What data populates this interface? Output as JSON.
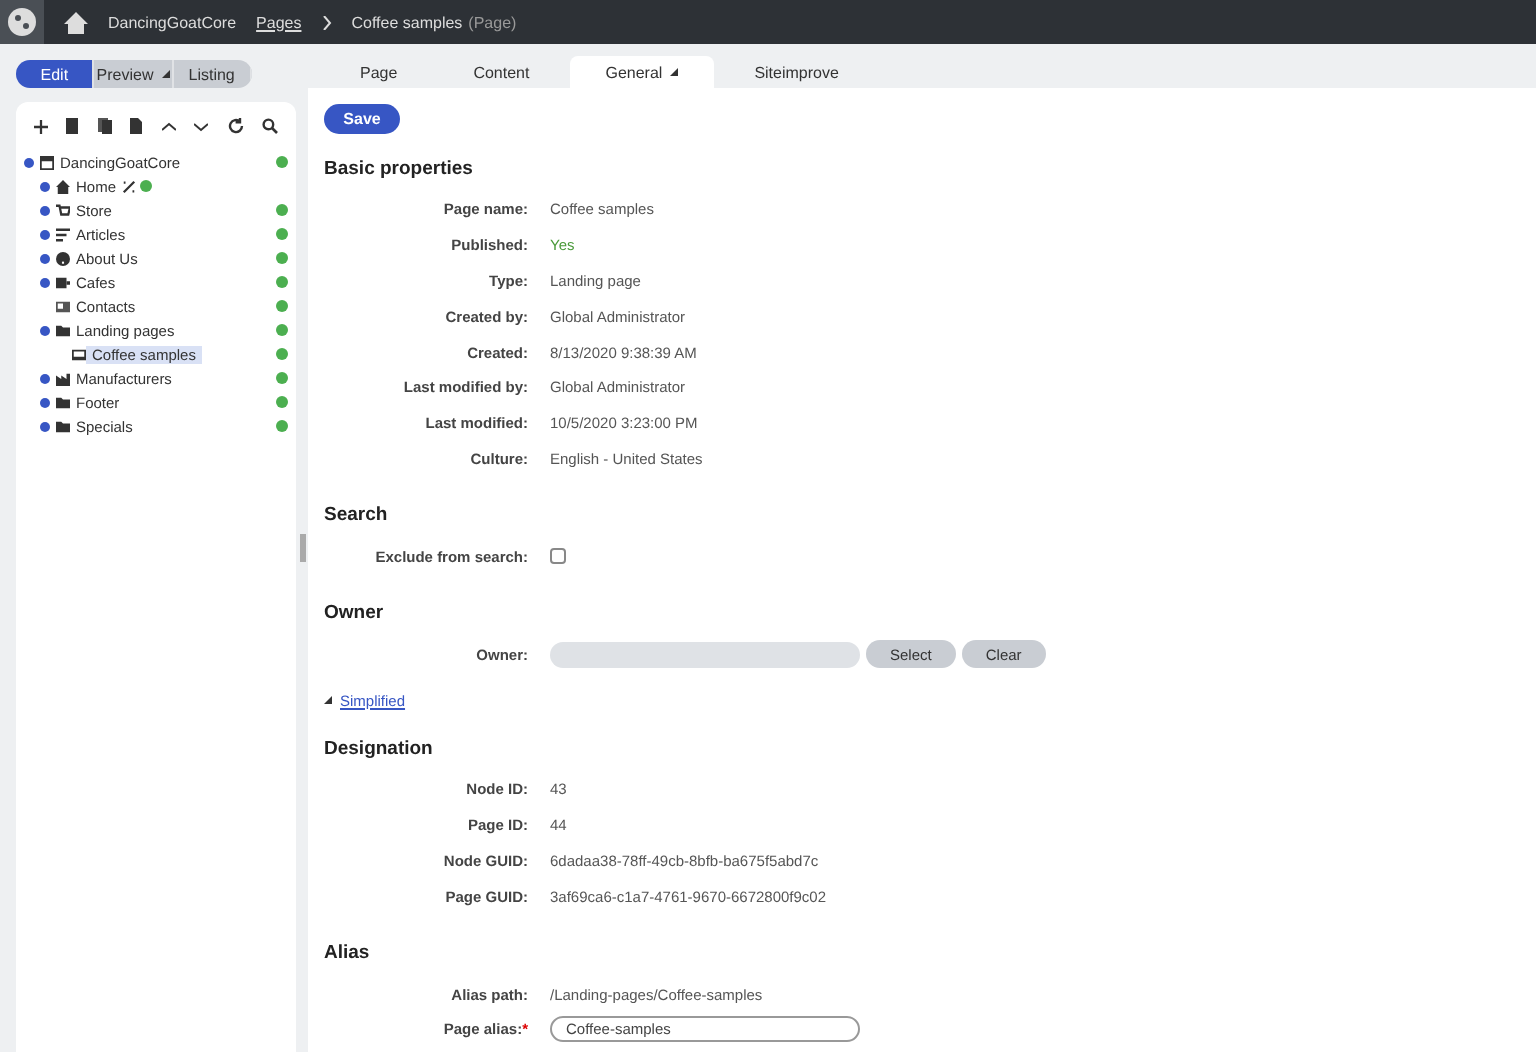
{
  "top_bar": {
    "site": "DancingGoatCore",
    "breadcrumb": [
      {
        "label": "Pages",
        "link": true
      },
      {
        "label": "Coffee samples",
        "link": false
      }
    ],
    "breadcrumb_type": "(Page)"
  },
  "modes": [
    {
      "label": "Edit",
      "selected": true
    },
    {
      "label": "Preview",
      "selected": false,
      "dropdown": true
    },
    {
      "label": "Listing",
      "selected": false
    }
  ],
  "tree": [
    {
      "label": "DancingGoatCore",
      "expandable": true,
      "selected": false,
      "children": [
        {
          "label": "Home",
          "expandable": true,
          "selected": false
        },
        {
          "label": "Store",
          "expandable": true,
          "selected": false
        },
        {
          "label": "Articles",
          "expandable": true,
          "selected": false
        },
        {
          "label": "About Us",
          "expandable": true,
          "selected": false
        },
        {
          "label": "Cafes",
          "expandable": true,
          "selected": false
        },
        {
          "label": "Contacts",
          "expandable": false,
          "selected": false
        },
        {
          "label": "Landing pages",
          "expandable": true,
          "selected": false,
          "children": [
            {
              "label": "Coffee samples",
              "expandable": false,
              "selected": true
            }
          ]
        },
        {
          "label": "Manufacturers",
          "expandable": true,
          "selected": false
        },
        {
          "label": "Footer",
          "expandable": true,
          "selected": false
        },
        {
          "label": "Specials",
          "expandable": true,
          "selected": false
        }
      ]
    }
  ],
  "tabs": [
    {
      "label": "Page",
      "selected": false
    },
    {
      "label": "Content",
      "selected": false
    },
    {
      "label": "General",
      "selected": true,
      "dropdown": true
    },
    {
      "label": "Siteimprove",
      "selected": false
    }
  ],
  "save_button": "Save",
  "sections": [
    {
      "title": "Basic properties",
      "fields": [
        {
          "kind": "text",
          "label": "Page name:",
          "value": "Coffee samples"
        },
        {
          "kind": "status",
          "label": "Published:",
          "value": "Yes"
        },
        {
          "kind": "text",
          "label": "Type:",
          "value": "Landing page"
        },
        {
          "kind": "text",
          "label": "Created by:",
          "value": "Global Administrator"
        },
        {
          "kind": "text",
          "label": "Created:",
          "value": "8/13/2020 9:38:39 AM"
        },
        {
          "kind": "text",
          "label": "Last modified by:",
          "value": "Global Administrator"
        },
        {
          "kind": "text",
          "label": "Last modified:",
          "value": "10/5/2020 3:23:00 PM"
        },
        {
          "kind": "text",
          "label": "Culture:",
          "value": "English - United States"
        }
      ]
    },
    {
      "title": "Search",
      "fields": [
        {
          "kind": "checkbox",
          "label": "Exclude from search:",
          "checked": false
        }
      ]
    },
    {
      "title": "Owner",
      "fields": [
        {
          "kind": "selector",
          "label": "Owner:",
          "buttons": [
            "Select",
            "Clear"
          ]
        }
      ],
      "toggle_link": "Simplified"
    },
    {
      "title": "Designation",
      "fields": [
        {
          "kind": "text",
          "label": "Node ID:",
          "value": "43"
        },
        {
          "kind": "text",
          "label": "Page ID:",
          "value": "44"
        },
        {
          "kind": "text",
          "label": "Node GUID:",
          "value": "6dadaa38-78ff-49cb-8bfb-ba675f5abd7c"
        },
        {
          "kind": "text",
          "label": "Page GUID:",
          "value": "3af69ca6-c1a7-4761-9670-6672800f9c02"
        }
      ]
    },
    {
      "title": "Alias",
      "fields": [
        {
          "kind": "text",
          "label": "Alias path:",
          "value": "/Landing-pages/Coffee-samples"
        },
        {
          "kind": "input",
          "label": "Page alias:",
          "required_mark": "*",
          "value": "Coffee-samples"
        }
      ]
    }
  ]
}
